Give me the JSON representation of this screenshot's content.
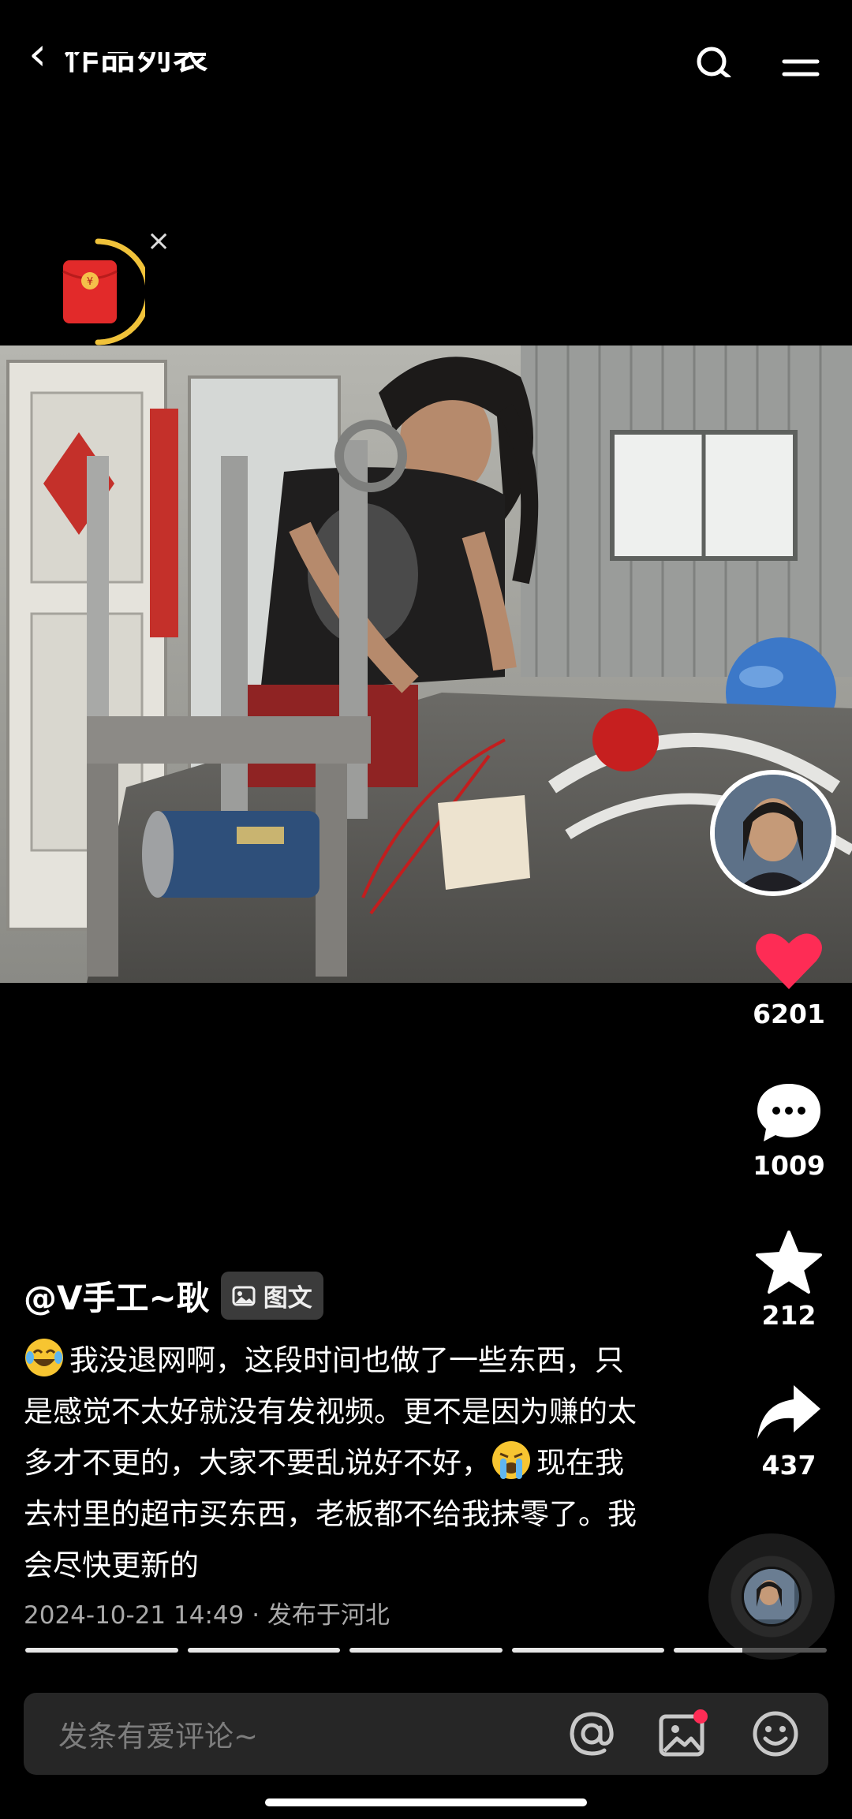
{
  "header": {
    "back_icon": "chevron-left-icon",
    "title": "作品列表",
    "right_icons": [
      "search-icon",
      "menu-icon"
    ]
  },
  "envelope": {
    "icon": "red-envelope-icon",
    "close_label": "×"
  },
  "actions": {
    "likes": "6201",
    "comments": "1009",
    "favorites": "212",
    "shares": "437",
    "like_color": "#fe2c55"
  },
  "post": {
    "author": "@V手工~耿",
    "type_tag": "图文",
    "caption_parts": [
      "我没退网啊，这段时间也做了一些东西，只是感觉不太好就没有发视频。更不是因为赚的太多才不更的，大家不要乱说好不好，",
      "现在我去村里的超市买东西，老板都不给我抹零了。我会尽快更新的"
    ],
    "emoji_icons": [
      "laughing-tears-emoji-icon",
      "crying-emoji-icon"
    ],
    "date": "2024-10-21 14:49",
    "location": "· 发布于河北"
  },
  "progress": {
    "segments": 5,
    "current_index": 4,
    "current_fraction": 0.45
  },
  "comment_bar": {
    "placeholder": "发条有爱评论~",
    "icons": [
      "at-mention-icon",
      "image-icon",
      "emoji-icon"
    ]
  }
}
